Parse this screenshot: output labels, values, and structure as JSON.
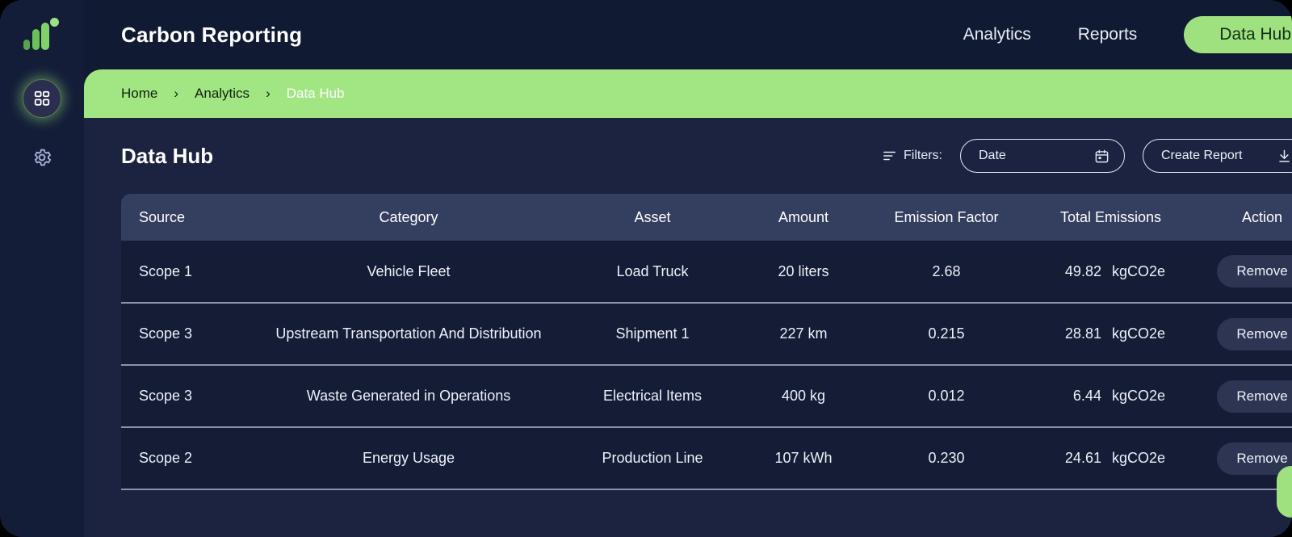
{
  "app": {
    "title": "Carbon Reporting",
    "logo_icon": "bar-chart-logo-icon"
  },
  "sidebar": {
    "items": [
      {
        "icon": "grid-dashboard-icon",
        "name": "dashboard",
        "active": true
      },
      {
        "icon": "gear-icon",
        "name": "settings",
        "active": false
      }
    ]
  },
  "topnav": {
    "links": [
      {
        "label": "Analytics"
      },
      {
        "label": "Reports"
      }
    ],
    "active_pill": "Data Hub"
  },
  "breadcrumb": {
    "items": [
      {
        "label": "Home",
        "active": false
      },
      {
        "label": "Analytics",
        "active": false
      },
      {
        "label": "Data Hub",
        "active": true
      }
    ],
    "separator": "›"
  },
  "page": {
    "title": "Data Hub"
  },
  "toolbar": {
    "filters_label": "Filters:",
    "filters_icon": "filter-lines-icon",
    "date_label": "Date",
    "date_icon": "calendar-icon",
    "create_report_label": "Create Report",
    "create_report_icon": "download-icon"
  },
  "table": {
    "columns": [
      "Source",
      "Category",
      "Asset",
      "Amount",
      "Emission Factor",
      "Total Emissions",
      "Action"
    ],
    "action_label": "Remove",
    "rows": [
      {
        "source": "Scope 1",
        "category": "Vehicle Fleet",
        "asset": "Load Truck",
        "amount": "20 liters",
        "factor": "2.68",
        "total_value": "49.82",
        "total_unit": "kgCO2e",
        "action": "Remove"
      },
      {
        "source": "Scope 3",
        "category": "Upstream Transportation And Distribution",
        "asset": "Shipment 1",
        "amount": "227 km",
        "factor": "0.215",
        "total_value": "28.81",
        "total_unit": "kgCO2e",
        "action": "Remove"
      },
      {
        "source": "Scope 3",
        "category": "Waste Generated in Operations",
        "asset": "Electrical Items",
        "amount": "400 kg",
        "factor": "0.012",
        "total_value": "6.44",
        "total_unit": "kgCO2e",
        "action": "Remove"
      },
      {
        "source": "Scope 2",
        "category": "Energy Usage",
        "asset": "Production Line",
        "amount": "107 kWh",
        "factor": "0.230",
        "total_value": "24.61",
        "total_unit": "kgCO2e",
        "action": "Remove"
      }
    ]
  },
  "chat": {
    "icon": "chat-bubbles-icon",
    "badge_icon": "bell-icon"
  },
  "colors": {
    "accent_green": "#9fe07f",
    "breadcrumb_green": "#a2e583",
    "panel_bg": "#1b2340",
    "row_bg": "#141c36",
    "table_header_bg": "#343e5e",
    "badge_red": "#e8536b"
  }
}
